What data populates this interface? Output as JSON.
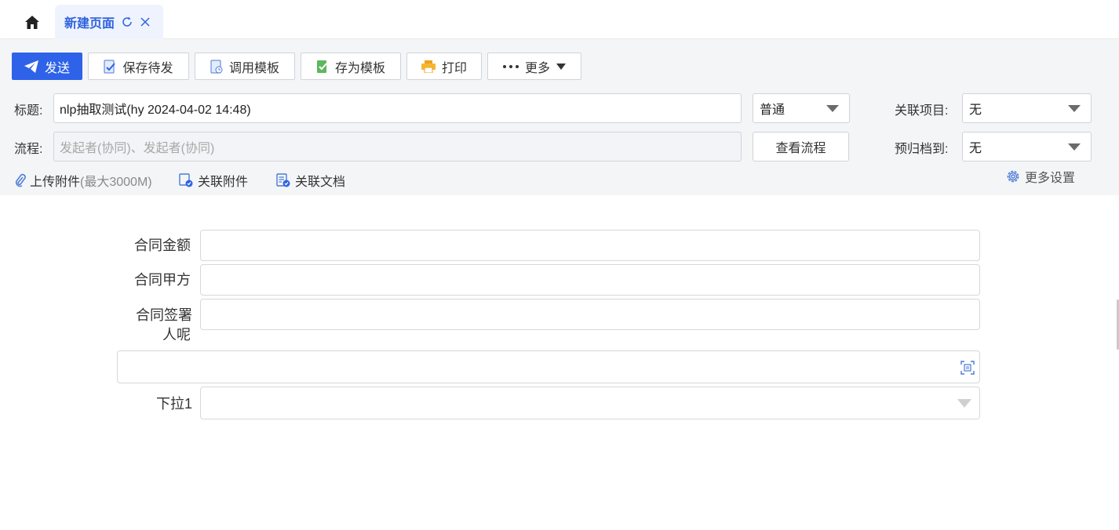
{
  "tabbar": {
    "home_icon": "home-icon",
    "active_tab": {
      "label": "新建页面",
      "refresh_icon": "refresh-icon",
      "close_icon": "close-icon"
    }
  },
  "toolbar": {
    "send": "发送",
    "save_draft": "保存待发",
    "use_template": "调用模板",
    "save_as_template": "存为模板",
    "print": "打印",
    "more": "更多"
  },
  "header": {
    "title_label": "标题:",
    "title_value": "nlp抽取测试(hy 2024-04-02 14:48)",
    "priority_value": "普通",
    "related_project_label": "关联项目:",
    "related_project_value": "无",
    "flow_label": "流程:",
    "flow_placeholder": "发起者(协同)、发起者(协同)",
    "view_flow": "查看流程",
    "archive_label": "预归档到:",
    "archive_value": "无",
    "upload_attachment": "上传附件",
    "upload_limit": "(最大3000M)",
    "related_attachment": "关联附件",
    "related_document": "关联文档",
    "more_settings": "更多设置"
  },
  "form": {
    "amount_label": "合同金额",
    "party_a_label": "合同甲方",
    "signer_label_line1": "合同签署",
    "signer_label_line2": "人呢",
    "dropdown_label": "下拉1"
  },
  "colors": {
    "primary": "#2e62e8",
    "tab_active_text": "#2f62dd",
    "header_bg": "#f4f5f7"
  }
}
